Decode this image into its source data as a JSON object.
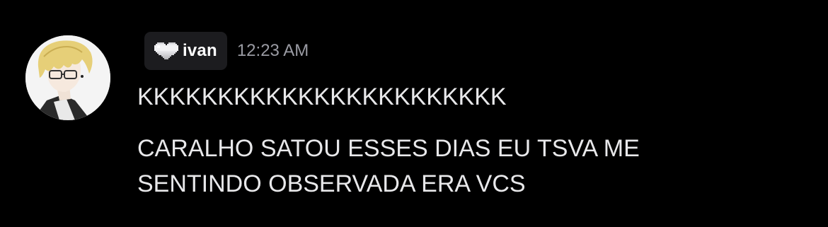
{
  "message": {
    "author": {
      "name": "ivan",
      "badge_icon": "pixel-heart-icon",
      "avatar": "anime-avatar"
    },
    "timestamp": "12:23 AM",
    "lines": [
      "KKKKKKKKKKKKKKKKKKKKKKK",
      "CARALHO SATOU ESSES DIAS EU TSVA ME",
      "SENTINDO OBSERVADA ERA VCS"
    ]
  },
  "colors": {
    "background": "#000000",
    "name_tag_bg": "#1c1c1f",
    "username": "#ffffff",
    "timestamp": "#9a9ba3",
    "text": "#e8e8ea"
  }
}
